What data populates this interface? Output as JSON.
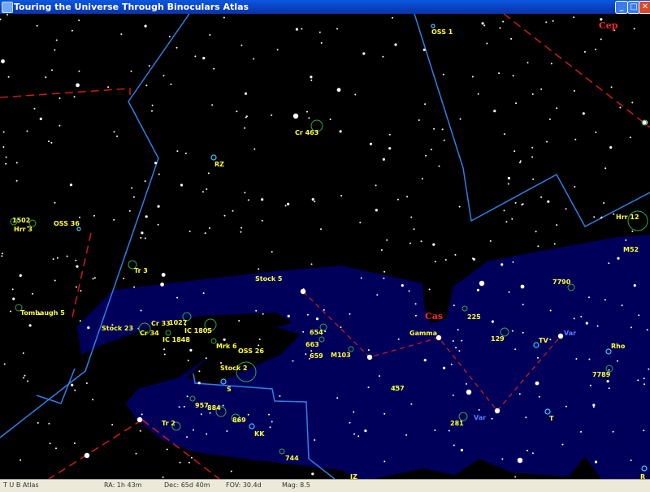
{
  "window": {
    "title": "Touring the Universe Through Binoculars Atlas"
  },
  "colors": {
    "milky_way": "#00005a",
    "constellation_line": "#2f7fe8",
    "boundary": "#d01a1a",
    "label": "#ffff33",
    "variable_label": "#5d7dff",
    "constellation_name": "#ff2a2a"
  },
  "constellations": {
    "cas": "Cas",
    "cep": "Cep"
  },
  "labels": {
    "oss1": "OSS 1",
    "cr463": "Cr 463",
    "rz": "RZ",
    "l1502": "1502",
    "hrr3": "Hrr 3",
    "oss36": "OSS 36",
    "hrr12": "Hrr 12",
    "m52": "M52",
    "tr3": "Tr 3",
    "stock5": "Stock 5",
    "tombaugh5": "Tombaugh 5",
    "l7790": "7790",
    "l225": "225",
    "gamma": "Gamma",
    "stock23": "Stock 23",
    "cr33": "Cr 33",
    "cr34": "Cr 34",
    "l1027": "1027",
    "ic1805": "IC 1805",
    "ic1848": "IC 1848",
    "l654": "654",
    "l663": "663",
    "l659": "659",
    "m103": "M103",
    "l129": "129",
    "tv": "TV",
    "rho": "Rho",
    "mrk6": "Mrk 6",
    "oss26": "OSS 26",
    "stock2": "Stock 2",
    "s": "S",
    "l7789": "7789",
    "l457": "457",
    "l957": "957",
    "l884": "884",
    "l869": "869",
    "tr2": "Tr 2",
    "kk": "KK",
    "l281": "281",
    "t": "T",
    "l744": "744",
    "iz": "IZ",
    "r": "R",
    "var_top": "Var",
    "var_bottom": "Var"
  },
  "status": {
    "flags": "T  U  B  Atlas",
    "ra": "RA: 1h 43m",
    "dec": "Dec: 65d 40m",
    "fov": "FOV: 30.4d",
    "mag": "Mag: 8.5"
  }
}
